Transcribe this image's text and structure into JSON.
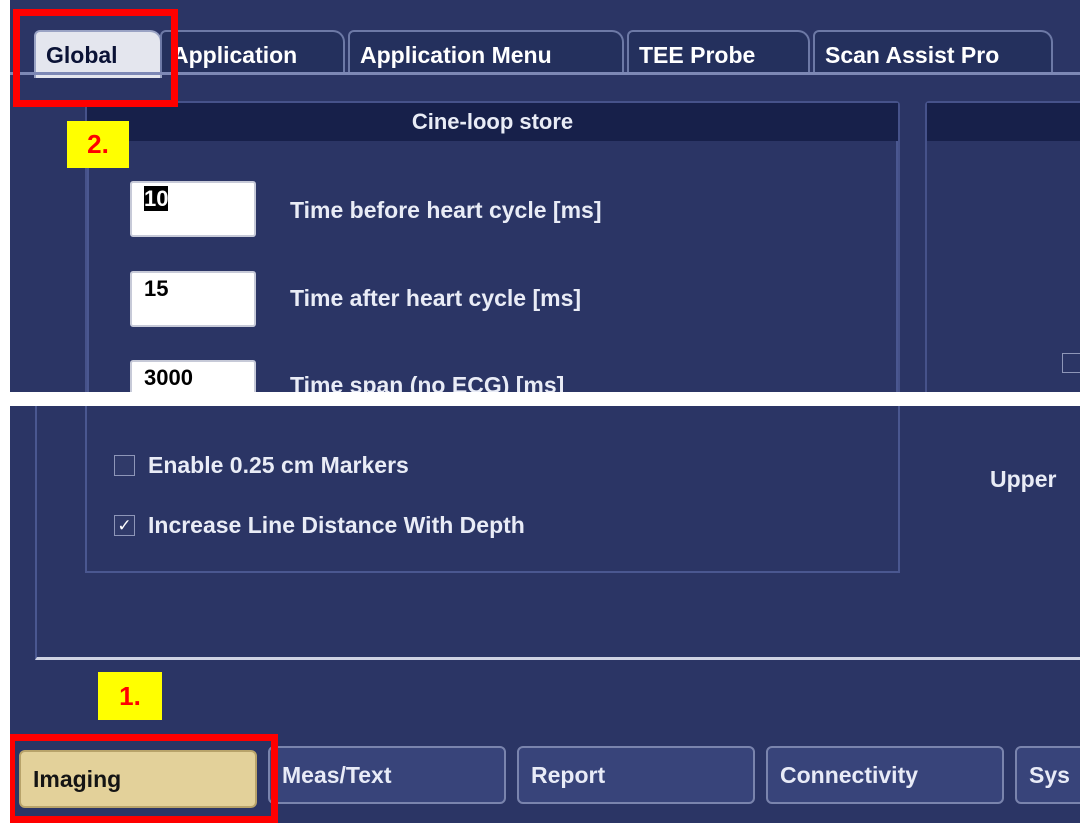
{
  "tabs": [
    {
      "label": "Global",
      "active": true
    },
    {
      "label": "Application",
      "active": false
    },
    {
      "label": "Application Menu",
      "active": false
    },
    {
      "label": "TEE Probe",
      "active": false
    },
    {
      "label": "Scan Assist Pro",
      "active": false
    }
  ],
  "cine_loop": {
    "title": "Cine-loop store",
    "fields": [
      {
        "value": "10",
        "label": "Time before heart cycle [ms]",
        "selected": true
      },
      {
        "value": "15",
        "label": "Time after heart cycle [ms]",
        "selected": false
      },
      {
        "value": "3000",
        "label": "Time span (no ECG) [ms]",
        "selected": false
      }
    ]
  },
  "options": [
    {
      "label": "Enable 0.25 cm Markers",
      "checked": false
    },
    {
      "label": "Increase Line Distance With Depth",
      "checked": true
    }
  ],
  "right_partial_label": "Upper",
  "bottom_buttons": [
    {
      "label": "Imaging",
      "active": true
    },
    {
      "label": "Meas/Text",
      "active": false
    },
    {
      "label": "Report",
      "active": false
    },
    {
      "label": "Connectivity",
      "active": false
    },
    {
      "label": "Sys",
      "active": false
    }
  ],
  "annotations": {
    "step1": "1.",
    "step2": "2."
  },
  "checkbox_checked_glyph": "✓",
  "colors": {
    "background": "#2b3565",
    "active_tab": "#e4e6ee",
    "active_button": "#e3d19a",
    "highlight_red": "#ff0000",
    "callout_yellow": "#ffff00"
  }
}
